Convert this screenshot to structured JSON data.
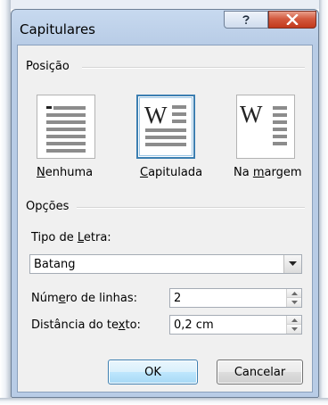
{
  "dialog": {
    "title": "Capitulares",
    "help_icon": "question-mark-icon",
    "close_icon": "close-x-icon"
  },
  "position": {
    "group_label": "Posição",
    "options": [
      {
        "pre": "",
        "accel": "N",
        "post": "enhuma",
        "icon": "no-dropcap-icon",
        "selected": false
      },
      {
        "pre": "",
        "accel": "C",
        "post": "apitulada",
        "icon": "dropped-cap-icon",
        "selected": true
      },
      {
        "pre": "Na ",
        "accel": "m",
        "post": "argem",
        "icon": "margin-cap-icon",
        "selected": false
      }
    ],
    "glyph": "W"
  },
  "options": {
    "group_label": "Opções",
    "font": {
      "pre": "Tipo de ",
      "accel": "L",
      "post": "etra:",
      "value": "Batang"
    },
    "lines": {
      "pre": "Núm",
      "accel": "e",
      "post": "ro de linhas:",
      "value": "2"
    },
    "distance": {
      "pre": "Distância do te",
      "accel": "x",
      "post": "to:",
      "value": "0,2 cm"
    }
  },
  "buttons": {
    "ok": "OK",
    "cancel": "Cancelar"
  },
  "colors": {
    "selection_border": "#3c7fb1",
    "close_button": "#c2391c",
    "dialog_face": "#f0f0f0"
  }
}
